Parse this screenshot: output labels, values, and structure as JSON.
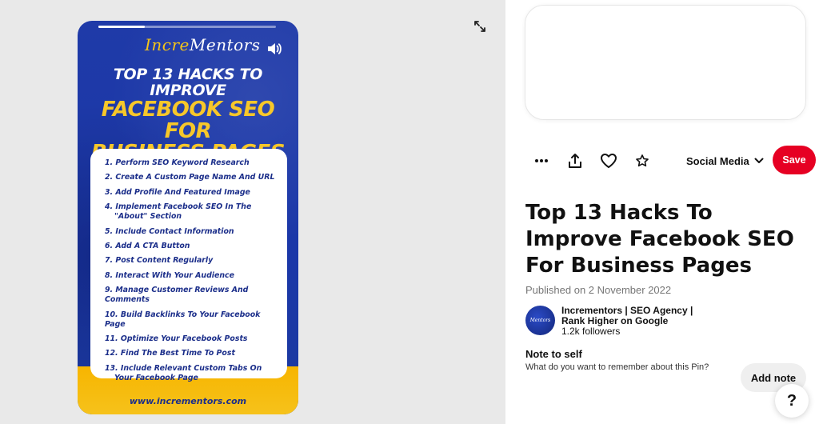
{
  "pin_image": {
    "logo_prefix": "Incre",
    "logo_suffix": "Mentors",
    "headline_line1": "TOP 13 HACKS TO IMPROVE",
    "headline_line2": "FACEBOOK SEO FOR",
    "headline_line3": "BUSINESS PAGES",
    "video_progress_percent": 26,
    "list_items": [
      "1. Perform SEO Keyword Research",
      "2. Create A Custom Page Name And URL",
      "3. Add Profile And Featured Image",
      "4. Implement Facebook SEO In The",
      "\"About\" Section",
      "5. Include Contact Information",
      "6. Add A CTA Button",
      "7. Post Content Regularly",
      "8. Interact With Your Audience",
      "9. Manage Customer Reviews And Comments",
      "10. Build Backlinks To Your Facebook Page",
      "11. Optimize Your Facebook Posts",
      "12. Find The Best Time To Post",
      "13. Include Relevant Custom Tabs On",
      "Your Facebook Page"
    ],
    "footer_url": "www.incrementors.com"
  },
  "actions": {
    "board_name": "Social Media",
    "save_label": "Save"
  },
  "pin": {
    "title": "Top 13 Hacks To Improve Facebook SEO For Business Pages",
    "published": "Published on 2 November 2022"
  },
  "creator": {
    "name": "Incrementors | SEO Agency | Rank Higher on Google",
    "followers": "1.2k followers"
  },
  "note": {
    "title": "Note to self",
    "prompt": "What do you want to remember about this Pin?",
    "add_label": "Add note"
  },
  "help": {
    "label": "?"
  },
  "colors": {
    "save_red": "#e60023",
    "pin_blue": "#1f3aa8",
    "pin_yellow": "#f7c72a"
  },
  "icons": [
    "expand-icon",
    "volume-icon",
    "more-icon",
    "share-icon",
    "heart-icon",
    "star-icon",
    "chevron-down-icon"
  ]
}
